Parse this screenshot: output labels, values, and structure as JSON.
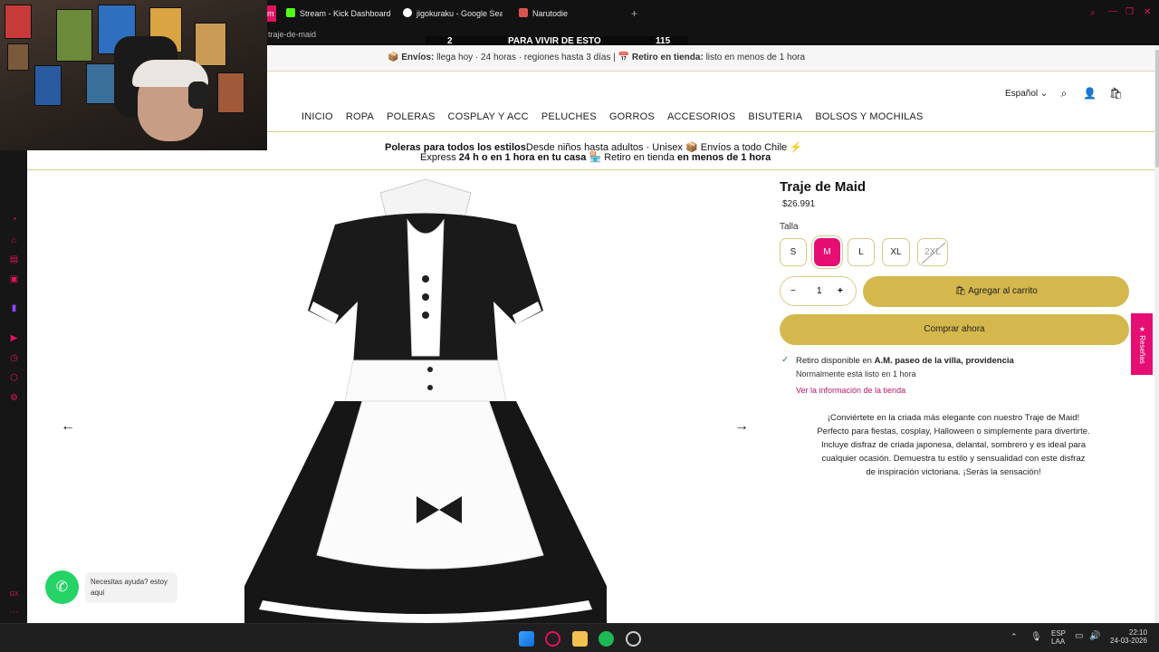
{
  "browser": {
    "tabs": [
      {
        "label": "m",
        "icon": "opera-gx-icon"
      },
      {
        "label": "Stream - Kick Dashboard",
        "icon": "kick-icon"
      },
      {
        "label": "jigokuraku - Google Search",
        "icon": "google-icon"
      },
      {
        "label": "Narutodie",
        "icon": "narutodie-icon"
      }
    ],
    "new_tab": "+",
    "url": "traje-de-maid",
    "overlay": {
      "left_num": "2",
      "text": "PARA VIVIR DE ESTO",
      "right_num": "115"
    }
  },
  "site": {
    "announcement": {
      "shipping_label": "Envíos:",
      "shipping_text": "llega hoy · 24 horas · regiones hasta 3 días |",
      "pickup_label": "Retiro en tienda:",
      "pickup_text": "listo en menos de 1 hora"
    },
    "language": "Español",
    "nav": [
      "INICIO",
      "ROPA",
      "POLERAS",
      "COSPLAY Y ACC",
      "PELUCHES",
      "GORROS",
      "ACCESORIOS",
      "BISUTERIA",
      "BOLSOS Y MOCHILAS"
    ],
    "promo": {
      "bold1": "Poleras para todos los estilos",
      "text1": "Desde niños hasta adultos · Unisex 📦 Envíos a todo Chile ⚡",
      "text2a": "Express ",
      "bold2": "24 h o en 1 hora en tu casa",
      "text2b": "🏪 Retiro en tienda ",
      "bold3": "en menos de 1 hora"
    },
    "product": {
      "title": "Traje de Maid",
      "price": "$26.991",
      "size_label": "Talla",
      "sizes": [
        "S",
        "M",
        "L",
        "XL",
        "2XL"
      ],
      "selected_size": "M",
      "quantity": "1",
      "add_to_cart": "Agregar al carrito",
      "buy_now": "Comprar ahora",
      "pickup_prefix": "Retiro disponible en ",
      "pickup_store": "A.M. paseo de la villa, providencia",
      "pickup_time": "Normalmente está listo en 1 hora",
      "store_link": "Ver la información de la tienda",
      "description": "¡Conviértete en la criada más elegante con nuestro Traje de Maid! Perfecto para fiestas, cosplay, Halloween o simplemente para divertirte. Incluye disfraz de criada japonesa, delantal, sombrero y es ideal para cualquier ocasión. Demuestra tu estilo y sensualidad con este disfraz de inspiración victoriana. ¡Serás la sensación!"
    },
    "reviews_tab": "★ Reseñas",
    "whatsapp_text": "Necesitas ayuda? estoy aqui"
  },
  "taskbar": {
    "lang1": "ESP",
    "lang2": "LAA",
    "time": "22:10",
    "date": "24-03-2026"
  },
  "colors": {
    "accent_pink": "#e60d73",
    "gold": "#d4b84d",
    "gold_border": "#d8c987"
  }
}
